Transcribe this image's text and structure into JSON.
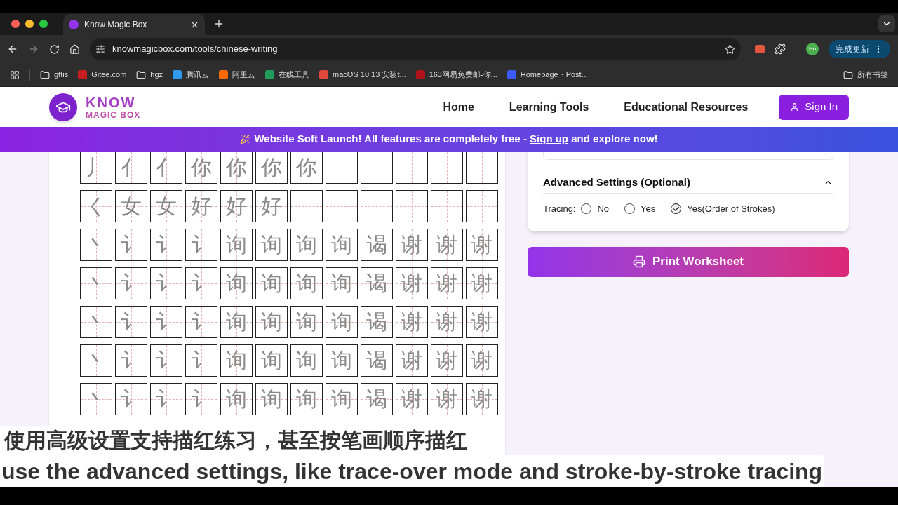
{
  "browser": {
    "tab_title": "Know Magic Box",
    "url": "knowmagicbox.com/tools/chinese-writing",
    "bookmarks": [
      {
        "label": "gttis",
        "kind": "folder"
      },
      {
        "label": "Gitee.com",
        "kind": "site",
        "color": "#c71d23"
      },
      {
        "label": "hgz",
        "kind": "folder"
      },
      {
        "label": "腾讯云",
        "kind": "site",
        "color": "#2f9bf0"
      },
      {
        "label": "阿里云",
        "kind": "site",
        "color": "#ff6a00"
      },
      {
        "label": "在线工具",
        "kind": "site",
        "color": "#1e9e5a"
      },
      {
        "label": "macOS 10.13 安装t...",
        "kind": "site",
        "color": "#e2483a"
      },
      {
        "label": "163网易免费邮-你...",
        "kind": "site",
        "color": "#b0131c"
      },
      {
        "label": "Homepage・Post...",
        "kind": "site",
        "color": "#3d5afe"
      }
    ],
    "profile": "Hu",
    "update_button": "完成更新",
    "all_bookmarks": "所有书签"
  },
  "header": {
    "logo_top": "KNOW",
    "logo_bottom": "MAGIC BOX",
    "nav": [
      "Home",
      "Learning Tools",
      "Educational Resources"
    ],
    "sign_in": "Sign In"
  },
  "banner": {
    "before": "Website Soft Launch! All features are completely free - ",
    "link": "Sign up",
    "after": " and explore now!"
  },
  "worksheet": {
    "rows": [
      [
        "丿",
        "亻",
        "亻",
        "你",
        "你",
        "你",
        "你",
        "",
        "",
        "",
        "",
        ""
      ],
      [
        "く",
        "女",
        "女",
        "好",
        "好",
        "好",
        "",
        "",
        "",
        "",
        "",
        ""
      ],
      [
        "丶",
        "讠",
        "讠",
        "讠",
        "询",
        "询",
        "询",
        "询",
        "谒",
        "谢",
        "谢",
        "谢"
      ],
      [
        "丶",
        "讠",
        "讠",
        "讠",
        "询",
        "询",
        "询",
        "询",
        "谒",
        "谢",
        "谢",
        "谢"
      ],
      [
        "丶",
        "讠",
        "讠",
        "讠",
        "询",
        "询",
        "询",
        "询",
        "谒",
        "谢",
        "谢",
        "谢"
      ],
      [
        "丶",
        "讠",
        "讠",
        "讠",
        "询",
        "询",
        "询",
        "询",
        "谒",
        "谢",
        "谢",
        "谢"
      ],
      [
        "丶",
        "讠",
        "讠",
        "讠",
        "询",
        "询",
        "询",
        "询",
        "谒",
        "谢",
        "谢",
        "谢"
      ]
    ]
  },
  "settings": {
    "title": "Advanced Settings (Optional)",
    "expanded": true,
    "tracing_label": "Tracing:",
    "options": [
      {
        "label": "No",
        "selected": false
      },
      {
        "label": "Yes",
        "selected": false
      },
      {
        "label": "Yes(Order of Strokes)",
        "selected": true
      }
    ]
  },
  "print_button": "Print Worksheet",
  "captions": {
    "zh": "使用高级设置支持描红练习，甚至按笔画顺序描红",
    "en": "use the advanced settings, like trace-over mode and stroke-by-stroke tracing"
  }
}
